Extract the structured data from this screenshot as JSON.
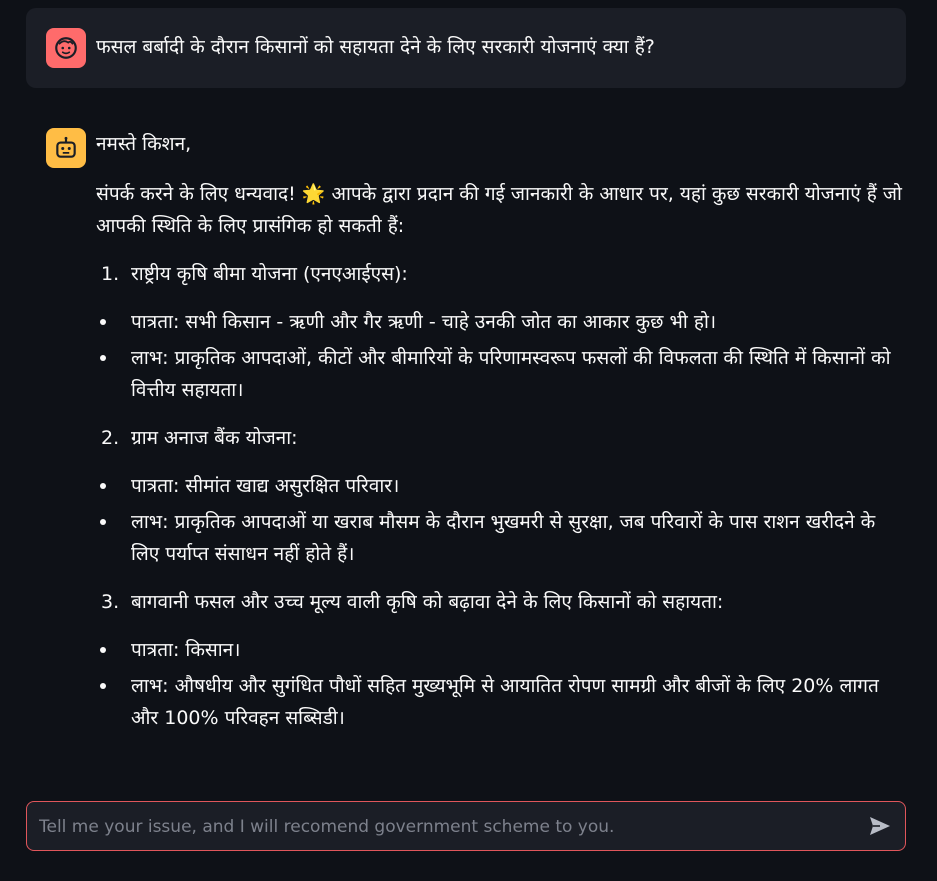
{
  "user_message": {
    "avatar_icon": "user-face-icon",
    "text": "फसल बर्बादी के दौरान किसानों को सहायता देने के लिए सरकारी योजनाएं क्या हैं?"
  },
  "assistant_message": {
    "avatar_icon": "robot-icon",
    "greeting": "नमस्ते किशन,",
    "intro_part1": "संपर्क करने के लिए धन्यवाद!",
    "intro_emoji": "🌟",
    "intro_part2": "आपके द्वारा प्रदान की गई जानकारी के आधार पर, यहां कुछ सरकारी योजनाएं हैं जो आपकी स्थिति के लिए प्रासंगिक हो सकती हैं:",
    "schemes": [
      {
        "number": "1.",
        "title": "राष्ट्रीय कृषि बीमा योजना (एनएआईएस):",
        "bullets": [
          "पात्रता: सभी किसान - ऋणी और गैर ऋणी - चाहे उनकी जोत का आकार कुछ भी हो।",
          "लाभ: प्राकृतिक आपदाओं, कीटों और बीमारियों के परिणामस्वरूप फसलों की विफलता की स्थिति में किसानों को वित्तीय सहायता।"
        ]
      },
      {
        "number": "2.",
        "title": "ग्राम अनाज बैंक योजना:",
        "bullets": [
          "पात्रता: सीमांत खाद्य असुरक्षित परिवार।",
          "लाभ: प्राकृतिक आपदाओं या खराब मौसम के दौरान भुखमरी से सुरक्षा, जब परिवारों के पास राशन खरीदने के लिए पर्याप्त संसाधन नहीं होते हैं।"
        ]
      },
      {
        "number": "3.",
        "title": "बागवानी फसल और उच्च मूल्य वाली कृषि को बढ़ावा देने के लिए किसानों को सहायता:",
        "bullets": [
          "पात्रता: किसान।",
          "लाभ: औषधीय और सुगंधित पौधों सहित मुख्यभूमि से आयातित रोपण सामग्री और बीजों के लिए 20% लागत और 100% परिवहन सब्सिडी।"
        ]
      }
    ]
  },
  "chat_input": {
    "placeholder": "Tell me your issue, and I will recomend government scheme to you.",
    "value": "",
    "send_icon": "send-icon"
  },
  "colors": {
    "background": "#0e1117",
    "user_avatar": "#ff6b6b",
    "bot_avatar": "#ffbd45",
    "input_border": "#e0565b"
  }
}
